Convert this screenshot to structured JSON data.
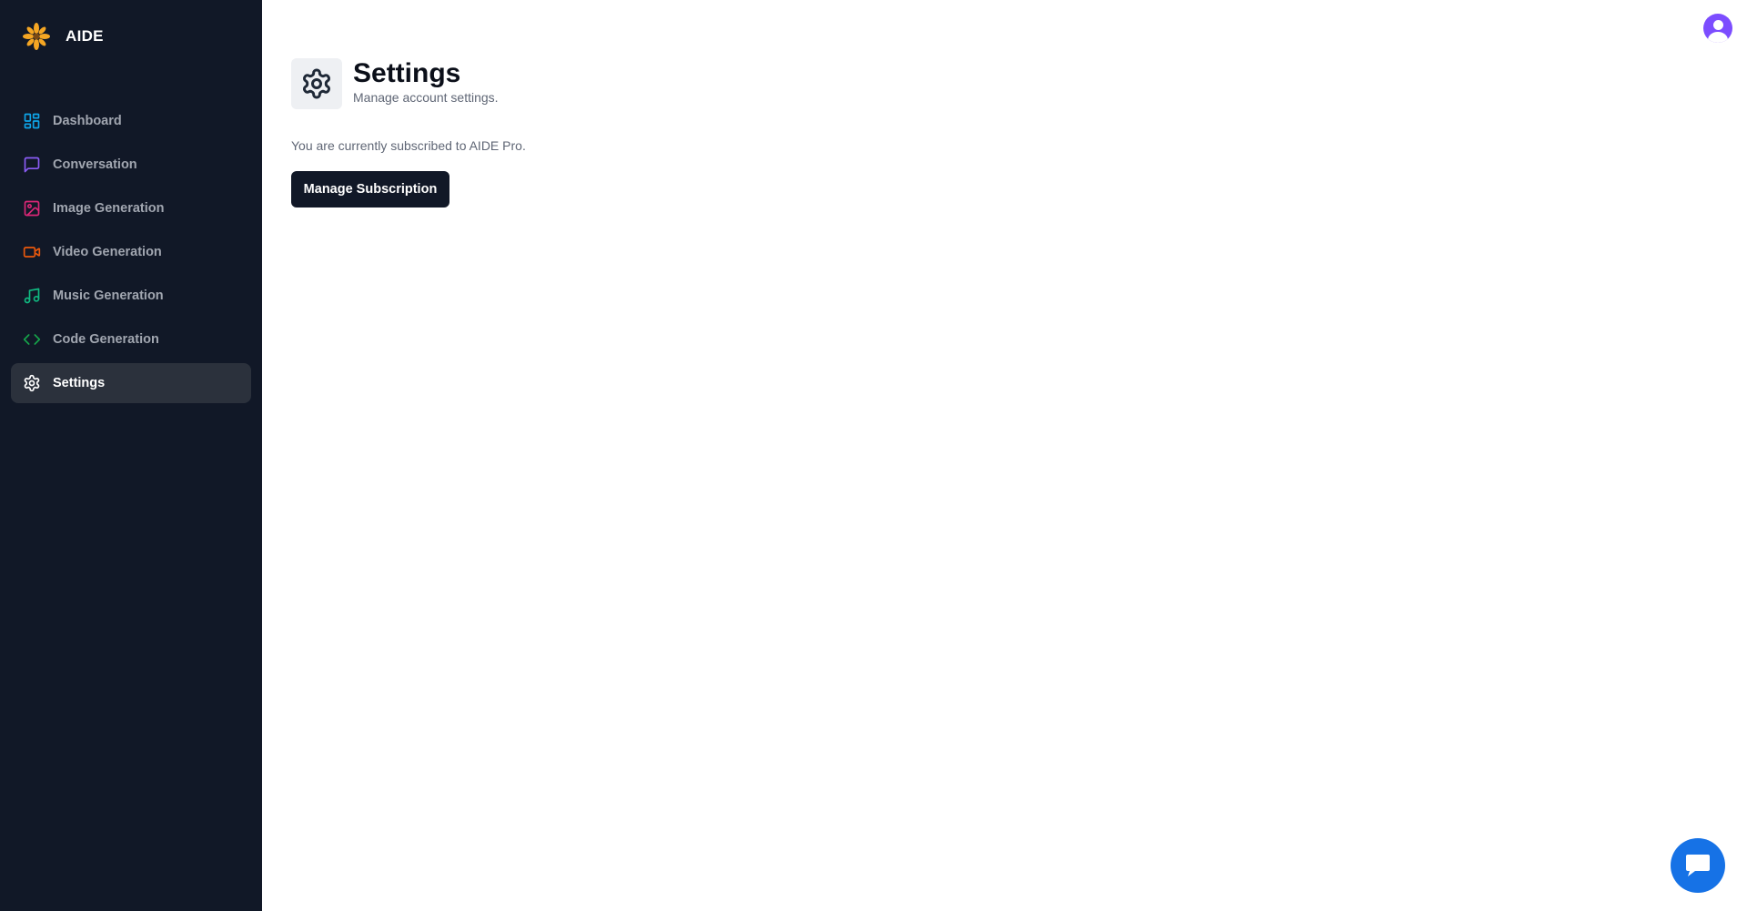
{
  "app": {
    "name": "AIDE"
  },
  "sidebar": {
    "items": [
      {
        "label": "Dashboard",
        "icon": "dashboard-icon",
        "color": "#0ea5e9",
        "active": false
      },
      {
        "label": "Conversation",
        "icon": "message-square-icon",
        "color": "#8b5cf6",
        "active": false
      },
      {
        "label": "Image Generation",
        "icon": "image-icon",
        "color": "#db2777",
        "active": false
      },
      {
        "label": "Video Generation",
        "icon": "video-icon",
        "color": "#ea580c",
        "active": false
      },
      {
        "label": "Music Generation",
        "icon": "music-icon",
        "color": "#10b981",
        "active": false
      },
      {
        "label": "Code Generation",
        "icon": "code-icon",
        "color": "#16a34a",
        "active": false
      },
      {
        "label": "Settings",
        "icon": "settings-icon",
        "color": "#ffffff",
        "active": true
      }
    ]
  },
  "header": {
    "avatar_icon": "user-avatar-icon"
  },
  "main": {
    "title": "Settings",
    "subtitle": "Manage account settings.",
    "subscription_text": "You are currently subscribed to AIDE Pro.",
    "manage_button_label": "Manage Subscription"
  },
  "chat_widget": {
    "icon": "chat-bubble-icon",
    "color": "#1672e6"
  }
}
